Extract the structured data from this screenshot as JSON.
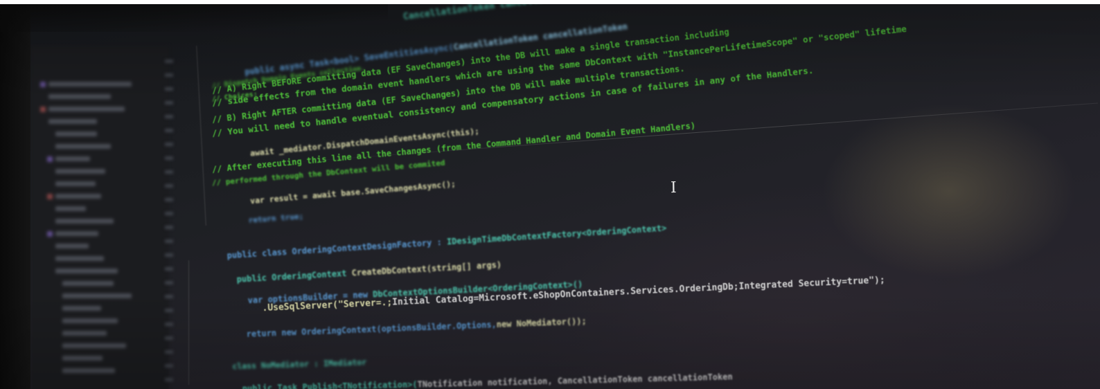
{
  "photo": {
    "subject": "code-editor-on-monitor",
    "accent_colors": {
      "comment": "#4fc23a",
      "keyword": "#5b9bd5",
      "type": "#4ec9b0",
      "method": "#dcdcaa",
      "string": "#d69d85",
      "text": "#d4d4d4",
      "background": "#1e1f23"
    },
    "cursor_icon": "text-cursor-icon",
    "cursor_glyph": "I"
  },
  "code": {
    "l01": "CancellationToken cancellationToken = default(",
    "l02a": "public async Task<bool> SaveEntitiesAsync(",
    "l02b": "CancellationToken cancellationToken",
    "l03": "// Dispatch Domain Events collection.",
    "l04": "// Choices:",
    "l05": "// A) Right BEFORE committing data (EF SaveChanges) into the DB will make a single transaction including",
    "l06": "// side effects from the domain event handlers which are using the same DbContext with \"InstancePerLifetimeScope\" or \"scoped\" lifetime",
    "l07": "// B) Right AFTER committing data (EF SaveChanges) into the DB will make multiple transactions.",
    "l08": "// You will need to handle eventual consistency and compensatory actions in case of failures in any of the Handlers.",
    "l09": "await _mediator.DispatchDomainEventsAsync(this);",
    "l10": "// After executing this line all the changes (from the Command Handler and Domain Event Handlers)",
    "l11": "// performed through the DbContext will be commited",
    "l12": "var result = await base.SaveChangesAsync();",
    "l13": "return true;",
    "l14a": "public class OrderingContextDesignFactory : ",
    "l14b": "IDesignTimeDbContextFactory<OrderingContext>",
    "l15a": "public OrderingContext ",
    "l15b": "CreateDbContext(string[] args)",
    "l16a": "var optionsBuilder = new ",
    "l16b": "DbContextOptionsBuilder<OrderingContext>()",
    "l17a": ".UseSqlServer(\"Server=.;",
    "l17b": "Initial Catalog=Microsoft.eShopOnContainers.Services.OrderingDb;Integrated Security=true\");",
    "l18a": "return new OrderingContext(optionsBuilder.Options,",
    "l18b": "new NoMediator());",
    "l19": "class NoMediator : IMediator",
    "l20a": "public Task Publish<TNotification>(",
    "l20b": "TNotification notification, CancellationToken cancellationToken"
  }
}
